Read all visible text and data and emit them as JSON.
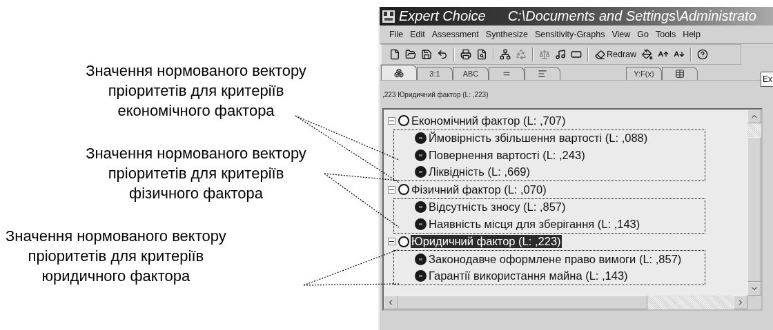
{
  "annotations": [
    {
      "text": "Значення нормованого вектору\nпріоритетів для критеріїв\nекономічного фактора"
    },
    {
      "text": "Значення нормованого вектору\nпріоритетів для критеріїв\nфізичного фактора"
    },
    {
      "text": "Значення нормованого вектору\nпріоритетів для критеріїв\nюридичного фактора"
    }
  ],
  "window": {
    "title": "Expert Choice",
    "path": "C:\\Documents and Settings\\Administrato"
  },
  "menu": [
    "File",
    "Edit",
    "Assessment",
    "Synthesize",
    "Sensitivity-Graphs",
    "View",
    "Go",
    "Tools",
    "Help"
  ],
  "toolbar": [
    {
      "kind": "icon",
      "disabled": false
    },
    {
      "kind": "icon",
      "disabled": false
    },
    {
      "kind": "icon",
      "disabled": false
    },
    {
      "kind": "icon",
      "disabled": false
    },
    {
      "kind": "separator"
    },
    {
      "kind": "icon",
      "disabled": false
    },
    {
      "kind": "icon",
      "disabled": false
    },
    {
      "kind": "separator"
    },
    {
      "kind": "icon",
      "disabled": false
    },
    {
      "kind": "icon",
      "disabled": true
    },
    {
      "kind": "separator"
    },
    {
      "kind": "icon",
      "disabled": true
    },
    {
      "kind": "icon",
      "disabled": false
    },
    {
      "kind": "icon",
      "disabled": false
    },
    {
      "kind": "separator"
    },
    {
      "kind": "text",
      "label": "Redraw"
    },
    {
      "kind": "icon",
      "disabled": false
    },
    {
      "kind": "icon",
      "disabled": false
    },
    {
      "kind": "icon",
      "disabled": false
    },
    {
      "kind": "separator"
    },
    {
      "kind": "icon",
      "disabled": false
    }
  ],
  "tabs": [
    {
      "kind": "icon",
      "selected": true
    },
    {
      "kind": "text",
      "label": "3:1",
      "selected": false
    },
    {
      "kind": "text",
      "label": "ABC",
      "selected": false
    },
    {
      "kind": "icon",
      "selected": false
    },
    {
      "kind": "icon",
      "selected": false
    },
    {
      "kind": "gap"
    },
    {
      "kind": "text",
      "label": "Y:F(x)",
      "selected": false
    },
    {
      "kind": "icon",
      "selected": false
    }
  ],
  "side_button": "Ex",
  "status_text": ",223 Юридичний фактор (L: ,223)",
  "tree": [
    {
      "label": "Економічний фактор (L: ,707)",
      "expanded": true,
      "selected": false,
      "children": [
        {
          "label": "Ймовірність збільшення вартості (L: ,088)",
          "selected": false
        },
        {
          "label": "Повернення вартості (L: ,243)",
          "selected": false
        },
        {
          "label": "Ліквідність (L: ,669)",
          "selected": false
        }
      ]
    },
    {
      "label": "Фізичний фактор (L: ,070)",
      "expanded": true,
      "selected": false,
      "children": [
        {
          "label": "Відсутність зносу (L: ,857)",
          "selected": false
        },
        {
          "label": "Наявність місця для зберігання (L: ,143)",
          "selected": false
        }
      ]
    },
    {
      "label": "Юридичний фактор (L: ,223)",
      "expanded": true,
      "selected": true,
      "children": [
        {
          "label": "Законодавче оформлене право вимоги (L: ,857)",
          "selected": false
        },
        {
          "label": "Гарантії використання майна (L: ,143)",
          "selected": false
        }
      ]
    }
  ]
}
